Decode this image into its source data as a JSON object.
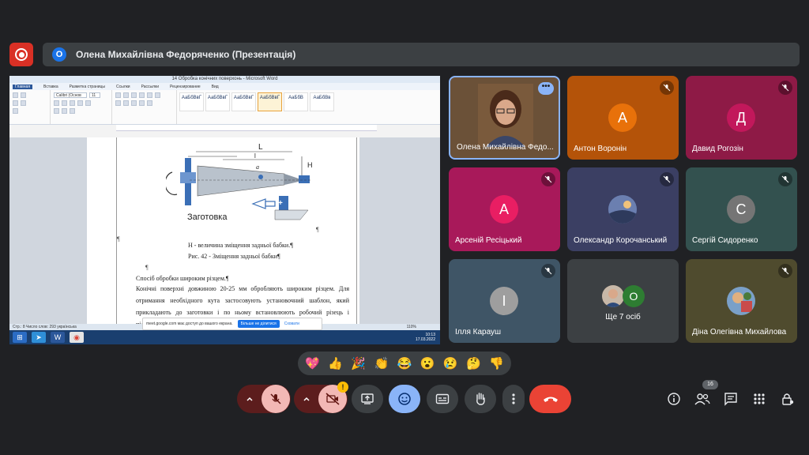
{
  "topbar": {
    "presenter_badge": "O",
    "presenter_title": "Олена Михайлівна Федоряченко (Презентація)"
  },
  "shared_screen": {
    "window_title": "14 Обробка конічних поверхонь - Microsoft Word",
    "ribbon_tabs": [
      "Главная",
      "Вставка",
      "Разметка страницы",
      "Ссылки",
      "Рассылки",
      "Рецензирование",
      "Вид"
    ],
    "font_name": "Calibri (Основ",
    "font_size": "11",
    "styles": [
      "АаБбВвГ",
      "АаБбВвГ",
      "АаБбВвГ",
      "АаБбВвГ",
      "АаБбВ",
      "АаБбВв"
    ],
    "figure_label": "Заготовка",
    "dim_L": "L",
    "dim_l": "l",
    "dim_a": "a",
    "dim_H": "H",
    "caption_1": "H - величина зміщення задньої бабки.¶",
    "caption_2": "Рис. 42 - Зміщення задньої бабки¶",
    "heading": "Спосіб обробки широким різцем.¶",
    "paragraph": "Конічні поверхні довжиною 20-25 мм обробляють широким різцем. Для отримання необхідного кута застосовують установочний шаблон, який прикладають до заготовки і по ньому встановлюють робочий різець і підводять",
    "notice_text": "meet.google.com має доступ до вашого екрана.",
    "notice_stop": "Більше не ділитися",
    "notice_hide": "Сховати",
    "status_text": "Стр.: 8   Число слов: 293   українська",
    "zoom": "110%",
    "clock_time": "10:13",
    "clock_date": "17.03.2022"
  },
  "participants": [
    {
      "name": "Олена Михайлівна Федо...",
      "initial": "",
      "color": "#7a5a3c"
    },
    {
      "name": "Антон Воронін",
      "initial": "А",
      "color": "#e8710a"
    },
    {
      "name": "Давид Рогозін",
      "initial": "Д",
      "color": "#c2185b"
    },
    {
      "name": "Арсеній Ресіцький",
      "initial": "А",
      "color": "#e91e63"
    },
    {
      "name": "Олександр Корочанський",
      "initial": "",
      "color": "#4a5d8c"
    },
    {
      "name": "Сергій Сидоренко",
      "initial": "С",
      "color": "#757575"
    },
    {
      "name": "Ілля Карауш",
      "initial": "І",
      "color": "#9e9e9e"
    },
    {
      "name": "Ще 7 осіб",
      "initial": "О",
      "color": "#2e7d32"
    },
    {
      "name": "Діна Олегівна Михайлова",
      "initial": "",
      "color": "#6d5e3a"
    }
  ],
  "reactions": [
    "💖",
    "👍",
    "🎉",
    "👏",
    "😂",
    "😮",
    "😢",
    "🤔",
    "👎"
  ],
  "controls": {
    "people_count": "16",
    "warning": "!"
  },
  "colors": {
    "background": "#202124",
    "danger": "#ea4335",
    "mic_off_bg": "#5c1d1d",
    "active_blue": "#8ab4f8"
  }
}
